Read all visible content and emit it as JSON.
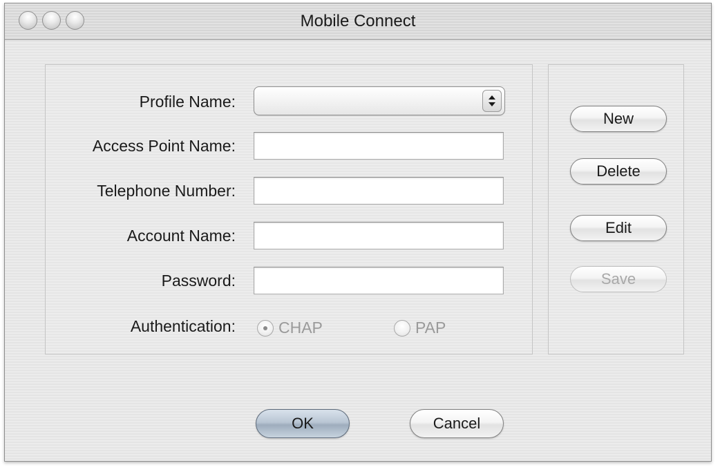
{
  "window": {
    "title": "Mobile Connect"
  },
  "form": {
    "profile_name": {
      "label": "Profile Name:",
      "value": ""
    },
    "access_point_name": {
      "label": "Access Point Name:",
      "value": ""
    },
    "telephone_number": {
      "label": "Telephone Number:",
      "value": ""
    },
    "account_name": {
      "label": "Account Name:",
      "value": ""
    },
    "password": {
      "label": "Password:",
      "value": ""
    },
    "authentication": {
      "label": "Authentication:",
      "options": [
        "CHAP",
        "PAP"
      ],
      "selected": "CHAP"
    }
  },
  "side_buttons": {
    "new": "New",
    "delete": "Delete",
    "edit": "Edit",
    "save": "Save"
  },
  "footer": {
    "ok": "OK",
    "cancel": "Cancel"
  },
  "colors": {
    "default_button": "#b9c6d4",
    "disabled_text": "#a8a8a8"
  }
}
